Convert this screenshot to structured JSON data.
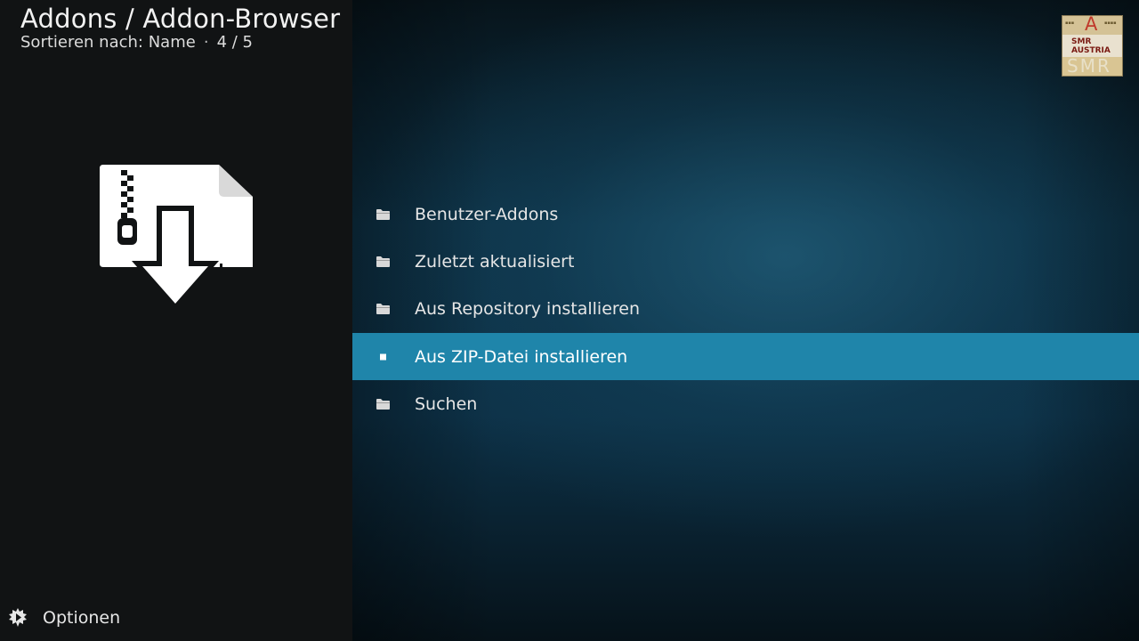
{
  "header": {
    "title": "Addons / Addon-Browser",
    "sort_label": "Sortieren nach: Name",
    "separator": "·",
    "position": "4 / 5"
  },
  "logo": {
    "letter_top": "A",
    "middle_text_1": "SMR",
    "middle_text_2": "AUSTRIA",
    "letters_bottom": "SMR"
  },
  "preview": {
    "icon": "zip-download-icon"
  },
  "menu": {
    "items": [
      {
        "label": "Benutzer-Addons",
        "icon": "folder-icon",
        "selected": false
      },
      {
        "label": "Zuletzt aktualisiert",
        "icon": "folder-icon",
        "selected": false
      },
      {
        "label": "Aus Repository installieren",
        "icon": "folder-icon",
        "selected": false
      },
      {
        "label": "Aus ZIP-Datei installieren",
        "icon": "square-bullet-icon",
        "selected": true
      },
      {
        "label": "Suchen",
        "icon": "folder-icon",
        "selected": false
      }
    ]
  },
  "footer": {
    "options_label": "Optionen",
    "options_icon": "options-gear-icon"
  },
  "colors": {
    "selection": "#1f85aa",
    "left_panel": "#111314",
    "background": "#0d3147"
  }
}
